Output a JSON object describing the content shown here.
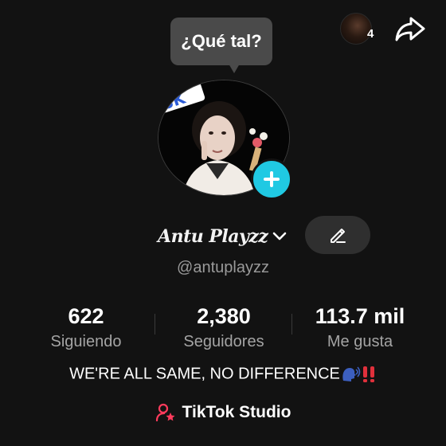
{
  "header": {
    "viewer_count": "4",
    "viewer_avatar_icon": "viewer-avatar",
    "share_icon": "share-arrow-icon"
  },
  "bubble": {
    "text": "¿Qué tal?"
  },
  "profile": {
    "avatar_icon": "profile-photo",
    "add_icon": "plus-icon",
    "display_name": "Antu Playzz",
    "username": "@antuplayzz",
    "edit_icon": "pencil-icon"
  },
  "stats": {
    "following": {
      "value": "622",
      "label": "Siguiendo"
    },
    "followers": {
      "value": "2,380",
      "label": "Seguidores"
    },
    "likes": {
      "value": "113.7 mil",
      "label": "Me gusta"
    }
  },
  "bio": {
    "text": "WE'RE ALL SAME, NO DIFFERENCE",
    "emoji": "speaking-head + double-exclamation"
  },
  "studio": {
    "label": "TikTok Studio",
    "icon": "user-star-icon"
  },
  "colors": {
    "background": "#121212",
    "accent": "#20c9e3",
    "secondary_text": "#9a9a9a"
  }
}
